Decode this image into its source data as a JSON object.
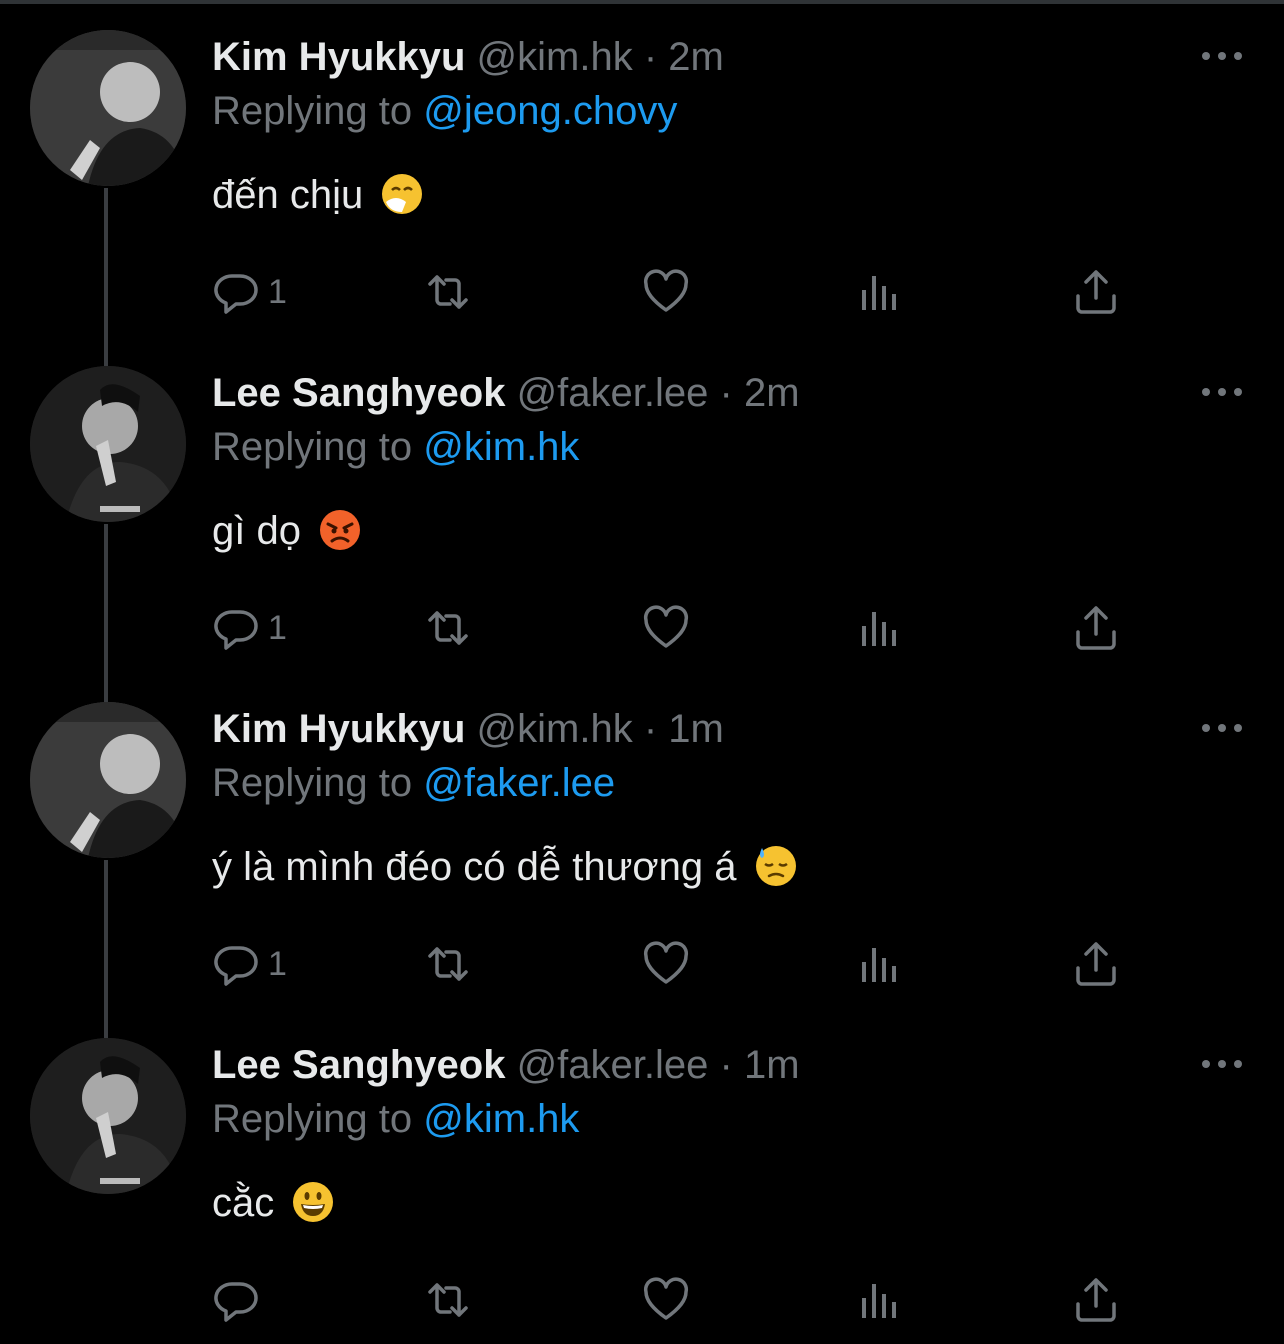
{
  "tweets": [
    {
      "name": "Kim Hyukkyu",
      "handle": "@kim.hk",
      "dot": "·",
      "time": "2m",
      "replying_prefix": "Replying to",
      "reply_to": "@jeong.chovy",
      "text": "đến chịu",
      "emoji": "sneezing-face-emoji",
      "reply_count": "1"
    },
    {
      "name": "Lee Sanghyeok",
      "handle": "@faker.lee",
      "dot": "·",
      "time": "2m",
      "replying_prefix": "Replying to",
      "reply_to": "@kim.hk",
      "text": "gì dọ",
      "emoji": "angry-face-emoji",
      "reply_count": "1"
    },
    {
      "name": "Kim Hyukkyu",
      "handle": "@kim.hk",
      "dot": "·",
      "time": "1m",
      "replying_prefix": "Replying to",
      "reply_to": "@faker.lee",
      "text": "ý là mình đéo có dễ thương á",
      "emoji": "downcast-face-with-sweat-emoji",
      "reply_count": "1"
    },
    {
      "name": "Lee Sanghyeok",
      "handle": "@faker.lee",
      "dot": "·",
      "time": "1m",
      "replying_prefix": "Replying to",
      "reply_to": "@kim.hk",
      "text": "cằc",
      "emoji": "grinning-face-emoji",
      "reply_count": ""
    }
  ],
  "colors": {
    "background": "#000000",
    "name": "#e7e9ea",
    "secondary": "#71767b",
    "link": "#1d9bf0",
    "thread_line": "#3a3d41"
  },
  "icons": [
    "reply-icon",
    "retweet-icon",
    "like-icon",
    "views-icon",
    "share-icon",
    "more-icon"
  ]
}
